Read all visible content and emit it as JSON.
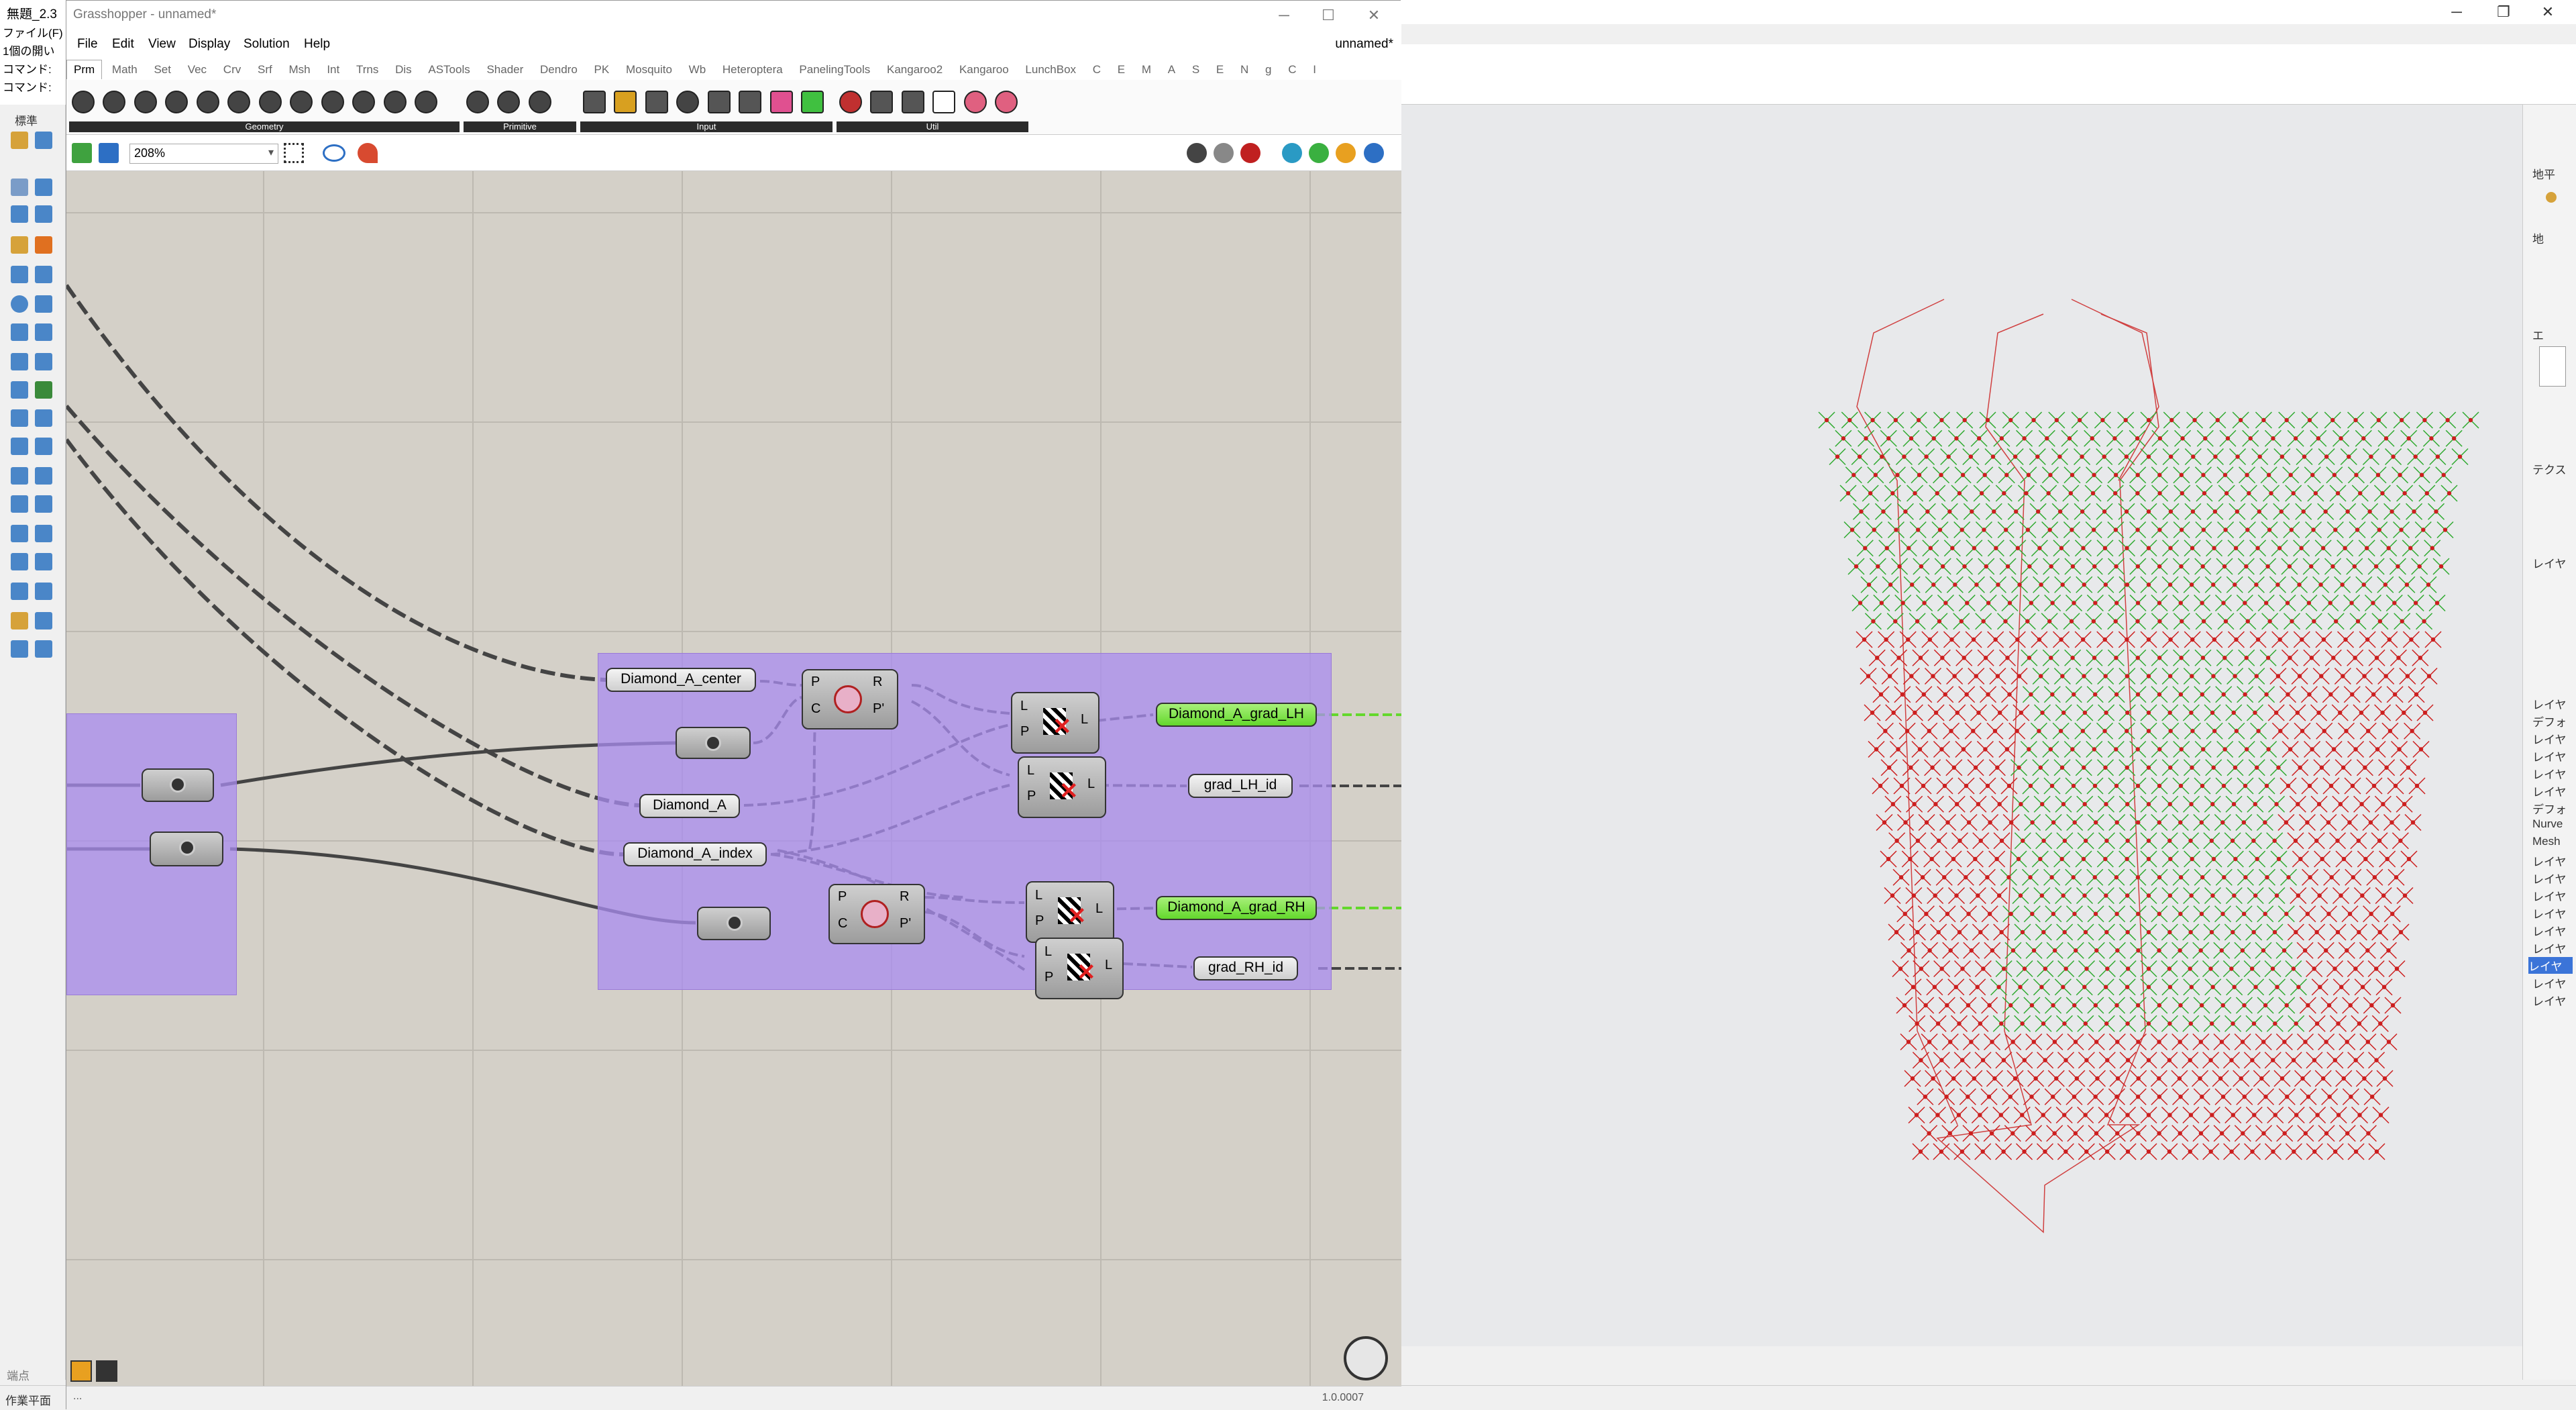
{
  "rhino": {
    "window_title": "無題_2.3",
    "command_lines": [
      "ファイル(F)  編",
      "1個の開い",
      "コマンド:",
      "コマンド:"
    ],
    "left_label": "標準",
    "status_left": "作業平面",
    "status_snap": "端点",
    "right_panel_items": [
      "地平",
      "地",
      "エ",
      "テクス",
      "レイヤ",
      "レイヤ",
      "デフォ",
      "レイヤ",
      "レイヤ",
      "レイヤ",
      "レイヤ",
      "デフォ",
      "Nurve",
      "Mesh",
      "レイヤ",
      "レイヤ",
      "レイヤ",
      "レイヤ",
      "レイヤ",
      "レイヤ",
      "レイヤ",
      "レイヤ",
      "レイヤ"
    ]
  },
  "gh": {
    "title": "Grasshopper - unnamed*",
    "doc_name": "unnamed*",
    "menu": [
      "File",
      "Edit",
      "View",
      "Display",
      "Solution",
      "Help"
    ],
    "tabs": [
      "Prm",
      "Math",
      "Set",
      "Vec",
      "Crv",
      "Srf",
      "Msh",
      "Int",
      "Trns",
      "Dis",
      "ASTools",
      "Shader",
      "Dendro",
      "PK",
      "Mosquito",
      "Wb",
      "Heteroptera",
      "PanelingTools",
      "Kangaroo2",
      "Kangaroo",
      "LunchBox",
      "C",
      "E",
      "M",
      "A",
      "S",
      "E",
      "N",
      "g",
      "C",
      "I"
    ],
    "ribbon_groups": [
      "Geometry",
      "Primitive",
      "Input",
      "Util"
    ],
    "zoom": "208%",
    "version": "1.0.0007",
    "status_left": "..."
  },
  "canvas": {
    "params": {
      "center": "Diamond_A_center",
      "diamond": "Diamond_A",
      "index": "Diamond_A_index",
      "grad_lh": "Diamond_A_grad_LH",
      "grad_lh_id": "grad_LH_id",
      "grad_rh": "Diamond_A_grad_RH",
      "grad_rh_id": "grad_RH_id"
    },
    "ports": {
      "p": "P",
      "c": "C",
      "r": "R",
      "pprime": "P'",
      "l": "L"
    }
  },
  "colors": {
    "group_purple": "#aa8cf0",
    "param_green": "#63d82c",
    "mesh_green": "#2faa2f",
    "mesh_red": "#cc1f1f",
    "canvas_bg": "#d4d0c8"
  },
  "icons": [
    "paint-icon",
    "cull-icon",
    "knob-icon",
    "navigation-compass-icon",
    "save-icon",
    "open-icon",
    "eye-icon",
    "sketch-icon"
  ]
}
